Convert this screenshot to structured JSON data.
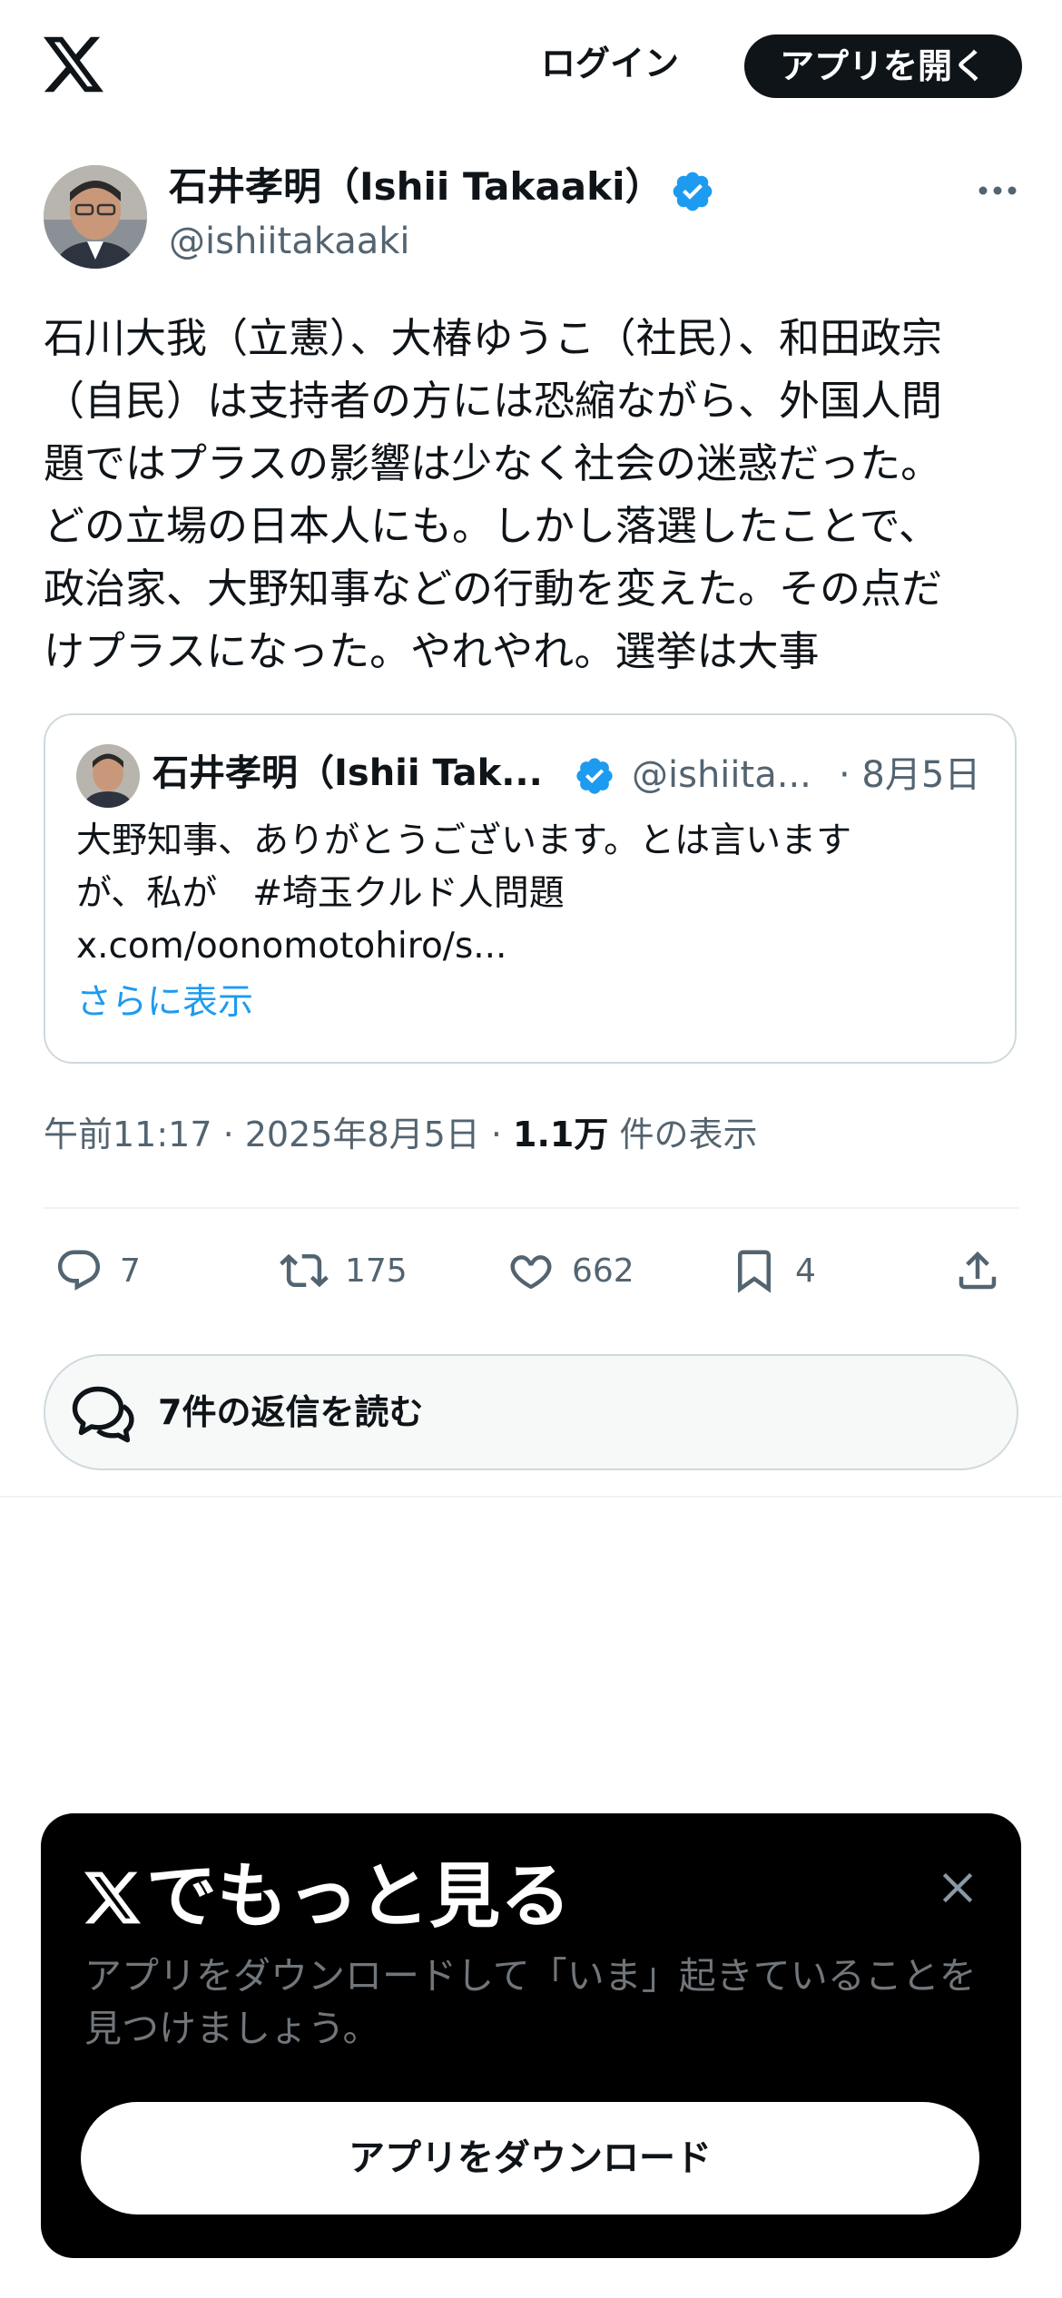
{
  "header": {
    "logo_icon": "x-logo-icon",
    "login_label": "ログイン",
    "open_app_label": "アプリを開く"
  },
  "post": {
    "author_name": "石井孝明（Ishii Takaaki）",
    "author_handle": "@ishiitakaaki",
    "verified": true,
    "text_lines": [
      "石川大我（立憲）、大椿ゆうこ（社民）、和田政宗",
      "（自民）は支持者の方には恐縮ながら、外国人問",
      "題ではプラスの影響は少なく社会の迷惑だった。",
      "どの立場の日本人にも。しかし落選したことで、",
      "政治家、大野知事などの行動を変えた。その点だ",
      "けプラスになった。やれやれ。選挙は大事"
    ],
    "quote": {
      "author_name": "石井孝明（Ishii Tak...",
      "author_handle": "@ishiita...",
      "date": "· 8月5日",
      "text_lines": [
        "大野知事、ありがとうございます。とは言います",
        "が、私が　#埼玉クルド人問題",
        "x.com/oonomotohiro/s..."
      ],
      "show_more": "さらに表示"
    },
    "timestamp": "午前11:17 · 2025年8月5日 · ",
    "views_count": "1.1万",
    "views_label": " 件の表示",
    "actions": {
      "reply_count": "7",
      "repost_count": "175",
      "like_count": "662",
      "bookmark_count": "4"
    },
    "read_replies_label": "7件の返信を読む"
  },
  "sheet": {
    "title": "でもっと見る",
    "description": "アプリをダウンロードして「いま」起きていることを見つけましょう。",
    "download_label": "アプリをダウンロード"
  },
  "colors": {
    "text": "#0f1419",
    "secondary": "#536471",
    "accent": "#1d9bf0",
    "border": "#cfd9de"
  }
}
